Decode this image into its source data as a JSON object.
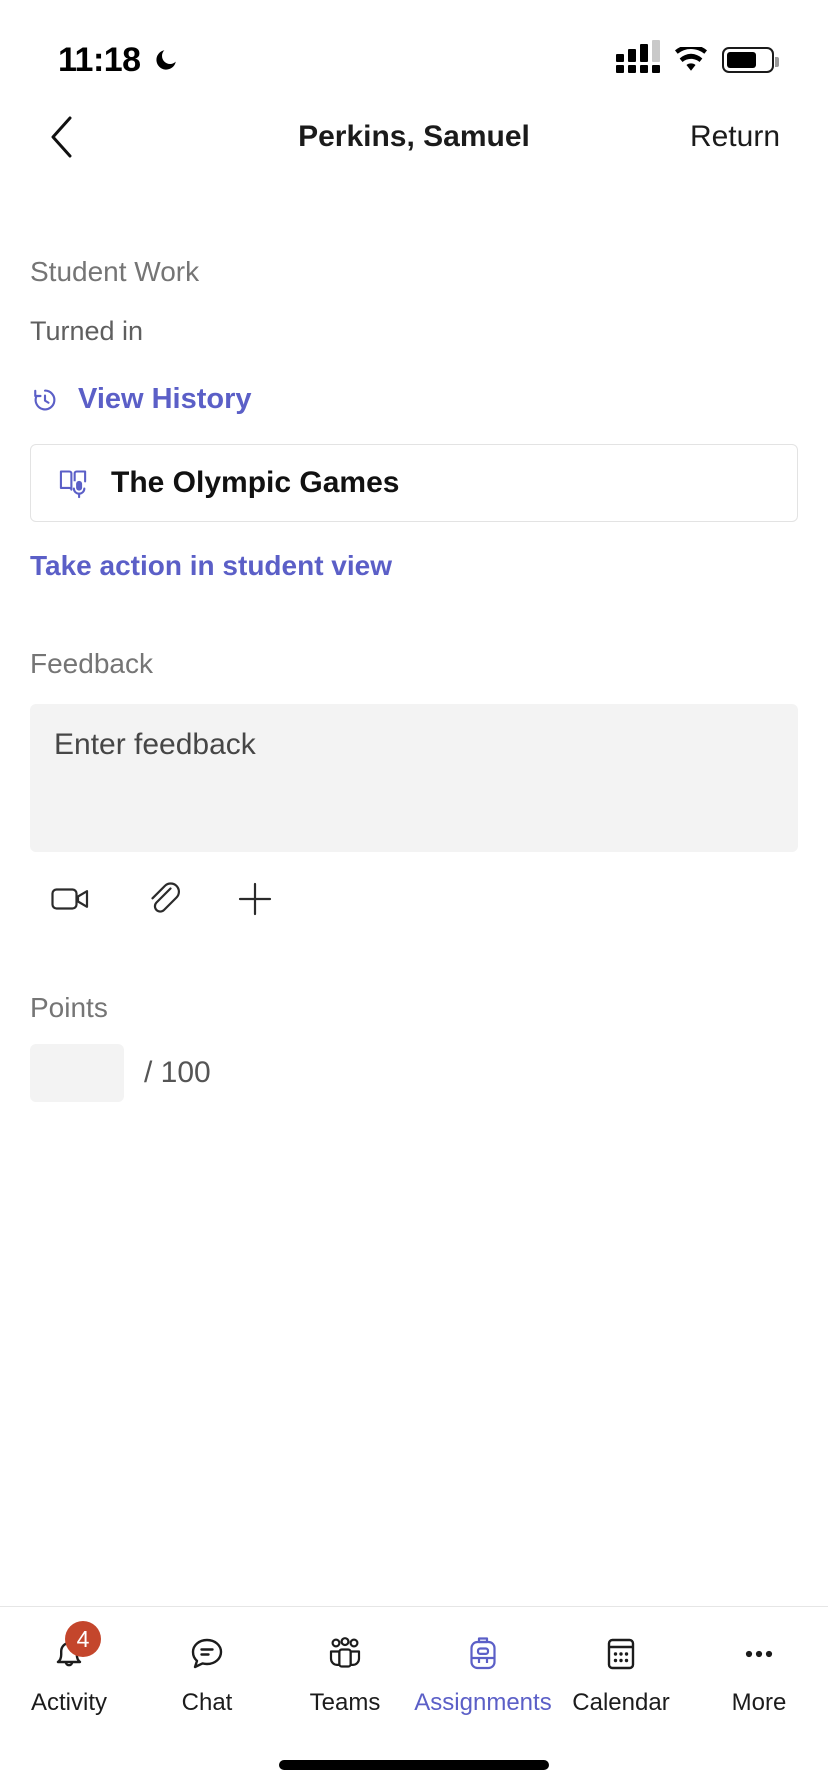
{
  "status_bar": {
    "time": "11:18",
    "dnd_icon": "crescent-moon-icon",
    "cellular_icon": "cellular-signal-icon",
    "wifi_icon": "wifi-icon",
    "battery_icon": "battery-icon",
    "battery_level_pct": 70
  },
  "header": {
    "back_icon": "chevron-left-icon",
    "title": "Perkins, Samuel",
    "return_label": "Return"
  },
  "main": {
    "student_work_label": "Student Work",
    "turned_in_status": "Turned in",
    "view_history": {
      "icon": "history-icon",
      "label": "View History"
    },
    "work_item": {
      "icon": "reading-progress-book-microphone-icon",
      "title": "The Olympic Games"
    },
    "take_action_label": "Take action in student view",
    "feedback": {
      "label": "Feedback",
      "value": "",
      "placeholder": "Enter feedback",
      "tools": [
        {
          "name": "video-icon",
          "label": "Record video"
        },
        {
          "name": "attach-icon",
          "label": "Attach file"
        },
        {
          "name": "plus-icon",
          "label": "Add"
        }
      ]
    },
    "points": {
      "label": "Points",
      "value": "",
      "total_label": "/ 100"
    }
  },
  "bottom_nav": {
    "items": [
      {
        "label": "Activity",
        "icon": "bell-icon",
        "active": false,
        "badge": "4"
      },
      {
        "label": "Chat",
        "icon": "chat-bubble-icon",
        "active": false,
        "badge": ""
      },
      {
        "label": "Teams",
        "icon": "teams-people-icon",
        "active": false,
        "badge": ""
      },
      {
        "label": "Assignments",
        "icon": "backpack-icon",
        "active": true,
        "badge": ""
      },
      {
        "label": "Calendar",
        "icon": "calendar-icon",
        "active": false,
        "badge": ""
      },
      {
        "label": "More",
        "icon": "ellipsis-icon",
        "active": false,
        "badge": ""
      }
    ]
  },
  "colors": {
    "accent_purple": "#5b5fc7",
    "badge_red": "#c4462c",
    "muted_text": "#757575",
    "field_bg": "#f3f3f3"
  }
}
